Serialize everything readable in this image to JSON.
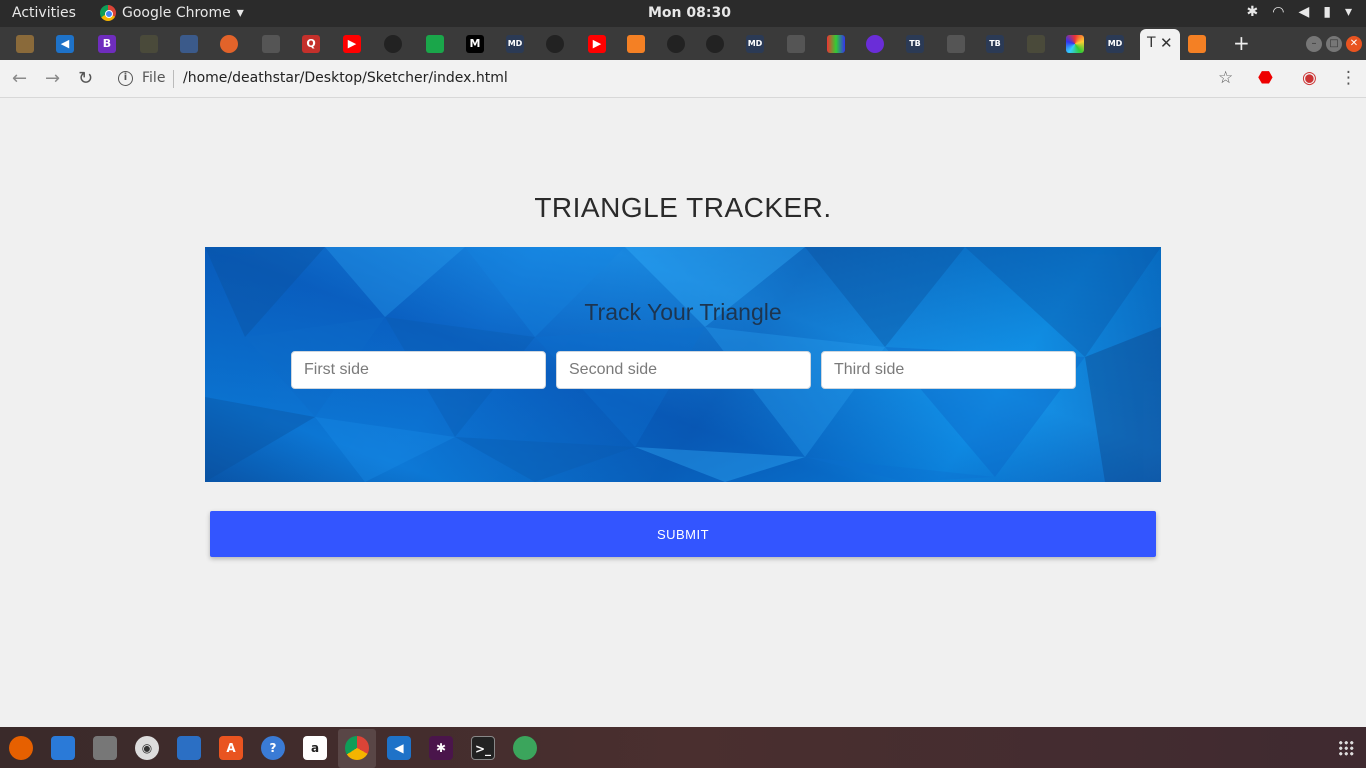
{
  "topbar": {
    "activities": "Activities",
    "app_name": "Google Chrome",
    "clock": "Mon 08:30"
  },
  "browser": {
    "active_tab_text": "T",
    "file_label": "File",
    "url": "/home/deathstar/Desktop/Sketcher/index.html"
  },
  "page": {
    "title": "TRIANGLE TRACKER.",
    "hero_heading": "Track Your Triangle",
    "inputs": [
      {
        "placeholder": "First side",
        "value": ""
      },
      {
        "placeholder": "Second side",
        "value": ""
      },
      {
        "placeholder": "Third side",
        "value": ""
      }
    ],
    "submit_label": "SUBMIT"
  },
  "colors": {
    "submit": "#3355ff",
    "hero_blue": "#0d7ad8"
  }
}
